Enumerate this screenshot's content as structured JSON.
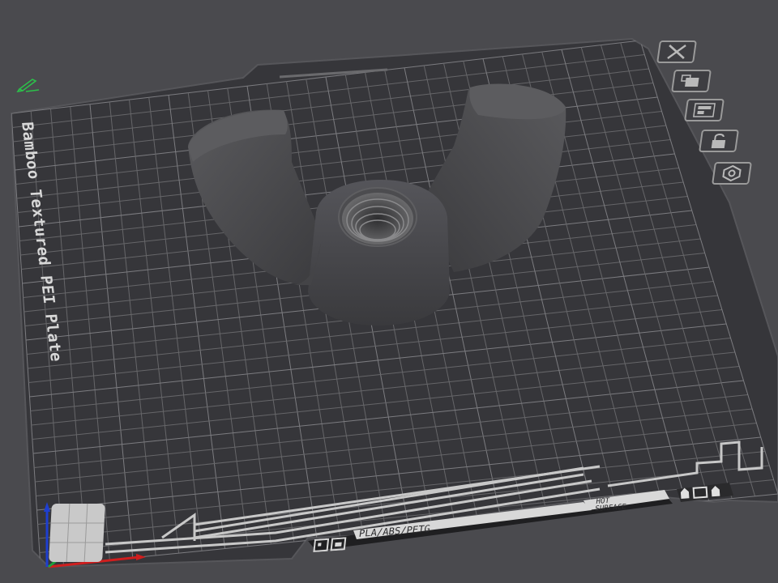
{
  "viewport": {
    "background_color": "#4a4a4e",
    "plate_color": "#36363a",
    "grid_color": "#6e6e72",
    "model_color": "#4b4b4d"
  },
  "plate": {
    "name": "Bamboo Textured PEI Plate",
    "filament_types": "PLA/ABS/PETG",
    "surface_warning_line1": "HOT",
    "surface_warning_line2": "SURFACE"
  },
  "model": {
    "name_icon": "wing-nut-model"
  },
  "plate_tools": [
    {
      "name": "close-plate-icon"
    },
    {
      "name": "arrange-plate-icon"
    },
    {
      "name": "auto-orient-icon"
    },
    {
      "name": "lock-plate-icon"
    },
    {
      "name": "plate-settings-icon"
    }
  ],
  "edit_icon": "pencil-icon"
}
